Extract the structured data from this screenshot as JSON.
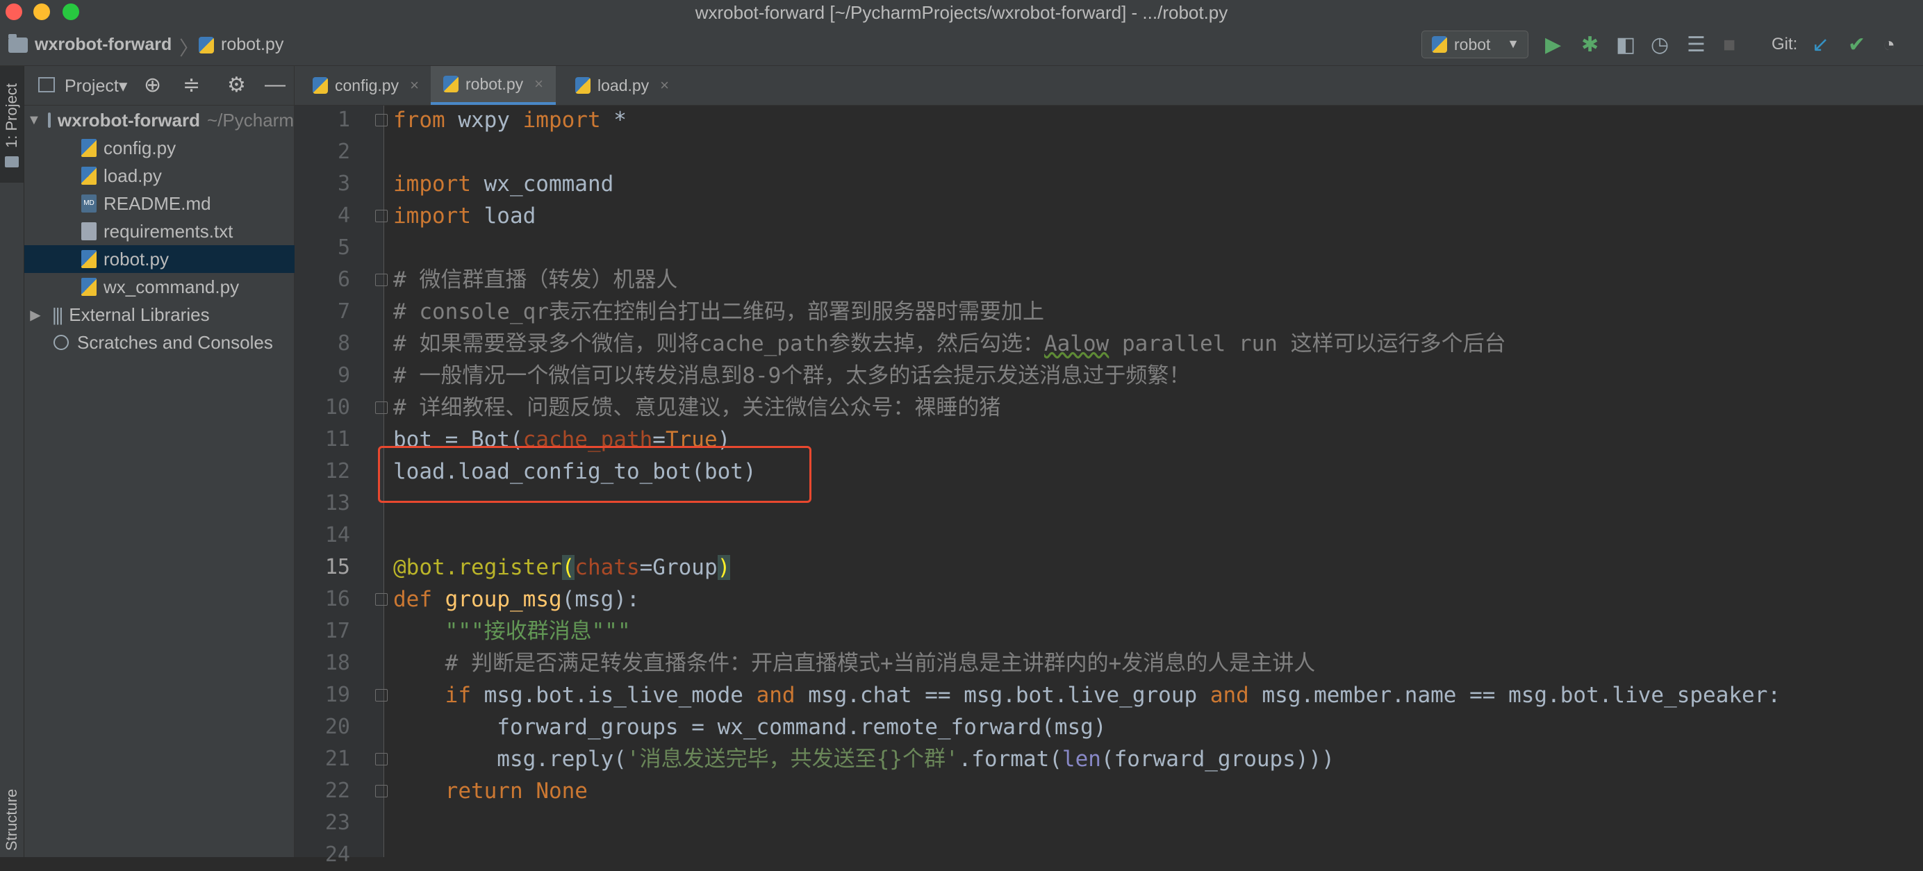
{
  "window": {
    "title": "wxrobot-forward [~/PycharmProjects/wxrobot-forward] - .../robot.py"
  },
  "navbar": {
    "project": "wxrobot-forward",
    "file": "robot.py",
    "run_config": "robot",
    "git_label": "Git:"
  },
  "left_strip": {
    "project_tab": "1: Project",
    "structure_tab": "Structure"
  },
  "project_panel": {
    "title": "Project",
    "root": "wxrobot-forward",
    "root_path": "~/Pycharm",
    "files": [
      {
        "name": "config.py",
        "type": "py"
      },
      {
        "name": "load.py",
        "type": "py"
      },
      {
        "name": "README.md",
        "type": "md"
      },
      {
        "name": "requirements.txt",
        "type": "txt"
      },
      {
        "name": "robot.py",
        "type": "py",
        "selected": true
      },
      {
        "name": "wx_command.py",
        "type": "py"
      }
    ],
    "external_libraries": "External Libraries",
    "scratches": "Scratches and Consoles"
  },
  "tabs": [
    {
      "label": "config.py",
      "active": false
    },
    {
      "label": "robot.py",
      "active": true
    },
    {
      "label": "load.py",
      "active": false
    }
  ],
  "editor": {
    "current_line": 15,
    "highlighted_line": 12,
    "lines": [
      {
        "n": "1",
        "text": "from wxpy import *"
      },
      {
        "n": "2",
        "text": ""
      },
      {
        "n": "3",
        "text": "import wx_command"
      },
      {
        "n": "4",
        "text": "import load"
      },
      {
        "n": "5",
        "text": ""
      },
      {
        "n": "6",
        "text": "# 微信群直播（转发）机器人"
      },
      {
        "n": "7",
        "text": "# console_qr表示在控制台打出二维码，部署到服务器时需要加上"
      },
      {
        "n": "8",
        "text": "# 如果需要登录多个微信，则将cache_path参数去掉，然后勾选：Aalow parallel run 这样可以运行多个后台"
      },
      {
        "n": "9",
        "text": "# 一般情况一个微信可以转发消息到8-9个群，太多的话会提示发送消息过于频繁！"
      },
      {
        "n": "10",
        "text": "# 详细教程、问题反馈、意见建议，关注微信公众号：裸睡的猪"
      },
      {
        "n": "11",
        "text": "bot = Bot(cache_path=True)"
      },
      {
        "n": "12",
        "text": "load.load_config_to_bot(bot)"
      },
      {
        "n": "13",
        "text": ""
      },
      {
        "n": "14",
        "text": ""
      },
      {
        "n": "15",
        "text": "@bot.register(chats=Group)"
      },
      {
        "n": "16",
        "text": "def group_msg(msg):"
      },
      {
        "n": "17",
        "text": "    \"\"\"接收群消息\"\"\""
      },
      {
        "n": "18",
        "text": "    # 判断是否满足转发直播条件：开启直播模式+当前消息是主讲群内的+发消息的人是主讲人"
      },
      {
        "n": "19",
        "text": "    if msg.bot.is_live_mode and msg.chat == msg.bot.live_group and msg.member.name == msg.bot.live_speaker:"
      },
      {
        "n": "20",
        "text": "        forward_groups = wx_command.remote_forward(msg)"
      },
      {
        "n": "21",
        "text": "        msg.reply('消息发送完毕，共发送至{}个群'.format(len(forward_groups)))"
      },
      {
        "n": "22",
        "text": "    return None"
      },
      {
        "n": "23",
        "text": ""
      },
      {
        "n": "24",
        "text": ""
      }
    ]
  },
  "colors": {
    "keyword": "#cc7832",
    "comment": "#808080",
    "string": "#6a8759",
    "function": "#ffc66d",
    "decorator": "#bbb529",
    "highlight_box": "#e8482f"
  }
}
